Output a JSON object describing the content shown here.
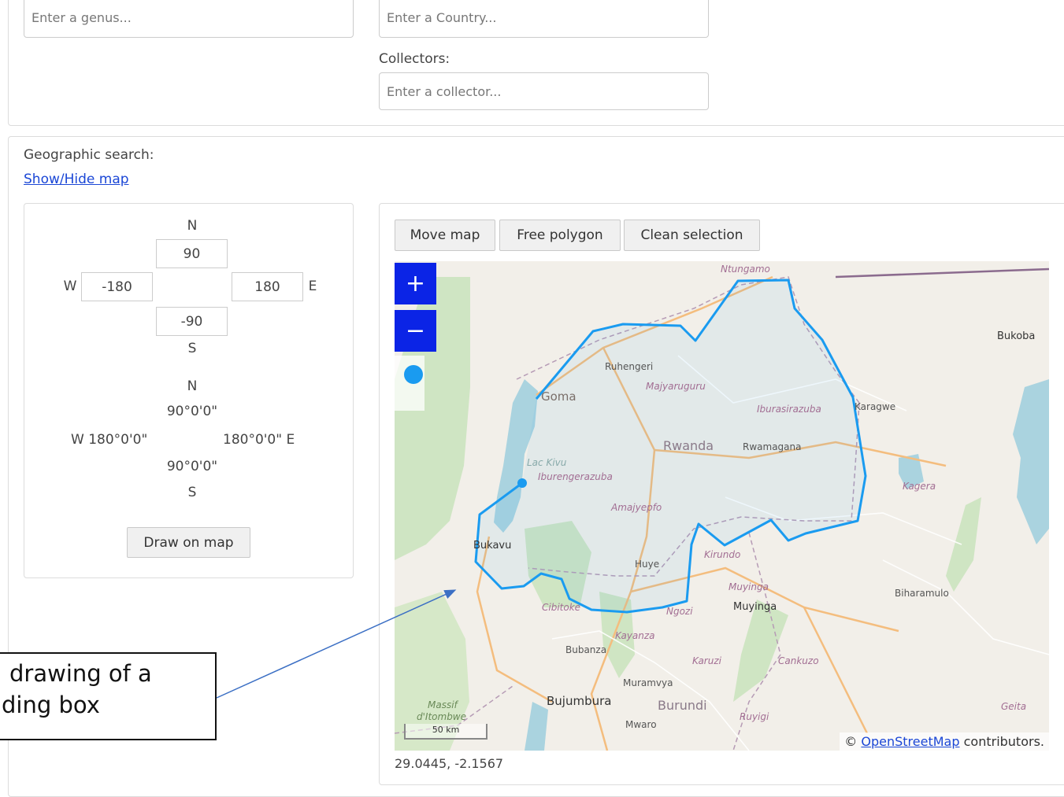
{
  "filters": {
    "genus_placeholder": "Enter a genus...",
    "country_placeholder": "Enter a Country...",
    "collectors_label": "Collectors:",
    "collector_placeholder": "Enter a collector..."
  },
  "geo": {
    "title": "Geographic search:",
    "toggle_link": "Show/Hide map",
    "bbox": {
      "north_label": "N",
      "south_label": "S",
      "west_label": "W",
      "east_label": "E",
      "north_value": "90",
      "south_value": "-90",
      "west_value": "-180",
      "east_value": "180",
      "north_dms": "90°0'0\"",
      "west_dms": "W 180°0'0\"",
      "east_dms": "180°0'0\" E",
      "south_dms": "90°0'0\"",
      "draw_button": "Draw on map"
    }
  },
  "map": {
    "buttons": {
      "move": "Move map",
      "free_polygon": "Free polygon",
      "clean": "Clean selection"
    },
    "zoom_in": "+",
    "zoom_out": "−",
    "scale_label": "50 km",
    "attribution_prefix": "©",
    "attribution_link": "OpenStreetMap",
    "attribution_suffix": "contributors.",
    "coordinates": "29.0445, -2.1567",
    "labels": {
      "ntungamo": "Ntungamo",
      "bukoba": "Bukoba",
      "ruhengeri": "Ruhengeri",
      "majyaruguru": "Majyaruguru",
      "goma": "Goma",
      "karagwe": "Karagwe",
      "iburasirazuba": "Iburasirazuba",
      "rwanda": "Rwanda",
      "rwamagana": "Rwamagana",
      "lac_kivu": "Lac Kivu",
      "iburengerazuba": "Iburengerazuba",
      "kagera": "Kagera",
      "amajyepfo": "Amajyepfo",
      "bukavu": "Bukavu",
      "kirundo": "Kirundo",
      "huye": "Huye",
      "muyinga_it": "Muyinga",
      "muyinga": "Muyinga",
      "biharamulo": "Biharamulo",
      "cibitoke": "Cibitoke",
      "ngozi": "Ngozi",
      "kayanza": "Kayanza",
      "bubanza": "Bubanza",
      "karuzi": "Karuzi",
      "cankuzo": "Cankuzo",
      "muramvya": "Muramvya",
      "bujumbura": "Bujumbura",
      "burundi": "Burundi",
      "massif": "Massif",
      "itombwe": "d'Itombwe",
      "ruyigi": "Ruyigi",
      "mwaro": "Mwaro",
      "geita": "Geita"
    }
  },
  "annotation": {
    "line1": "drawing of a",
    "line2": "ding box"
  },
  "colors": {
    "accent": "#0b24e6",
    "polygon": "#1a9bf0",
    "link": "#1b47d6"
  }
}
